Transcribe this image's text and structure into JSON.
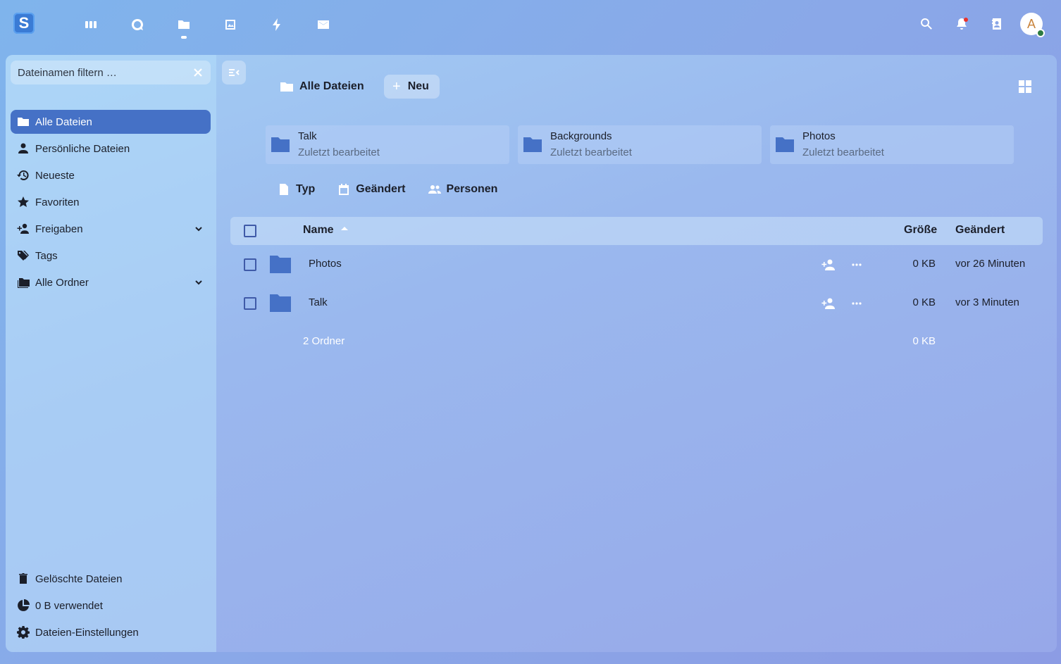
{
  "header": {
    "logo_letter": "S",
    "apps": [
      {
        "name": "dashboard-icon",
        "label": "Dashboard"
      },
      {
        "name": "talk-icon",
        "label": "Talk"
      },
      {
        "name": "files-icon",
        "label": "Files"
      },
      {
        "name": "photos-icon",
        "label": "Photos"
      },
      {
        "name": "activity-icon",
        "label": "Activity"
      },
      {
        "name": "mail-icon",
        "label": "Mail"
      }
    ],
    "active_app": "files",
    "avatar_letter": "A",
    "status_color": "#2d7b41"
  },
  "sidebar": {
    "filter_placeholder": "Dateinamen filtern …",
    "items": [
      {
        "label": "Alle Dateien",
        "icon": "folder-icon",
        "active": true
      },
      {
        "label": "Persönliche Dateien",
        "icon": "person-icon"
      },
      {
        "label": "Neueste",
        "icon": "history-icon"
      },
      {
        "label": "Favoriten",
        "icon": "star-icon"
      },
      {
        "label": "Freigaben",
        "icon": "share-icon",
        "expandable": true
      },
      {
        "label": "Tags",
        "icon": "tags-icon"
      },
      {
        "label": "Alle Ordner",
        "icon": "folders-icon",
        "expandable": true
      }
    ],
    "bottom": {
      "trash": "Gelöschte Dateien",
      "quota": "0 B verwendet",
      "settings": "Dateien-Einstellungen"
    }
  },
  "toolbar": {
    "breadcrumb": "Alle Dateien",
    "new_label": "Neu"
  },
  "recent": [
    {
      "name": "Talk",
      "subtitle": "Zuletzt bearbeitet"
    },
    {
      "name": "Backgrounds",
      "subtitle": "Zuletzt bearbeitet"
    },
    {
      "name": "Photos",
      "subtitle": "Zuletzt bearbeitet"
    }
  ],
  "filters": {
    "type": "Typ",
    "modified": "Geändert",
    "people": "Personen"
  },
  "table": {
    "headers": {
      "name": "Name",
      "size": "Größe",
      "modified": "Geändert"
    },
    "rows": [
      {
        "name": "Photos",
        "size": "0 KB",
        "modified": "vor 26 Minuten"
      },
      {
        "name": "Talk",
        "size": "0 KB",
        "modified": "vor 3 Minuten"
      }
    ],
    "summary": {
      "count": "2 Ordner",
      "size": "0 KB"
    }
  },
  "colors": {
    "accent": "#4571c6",
    "folder": "#4571c6"
  }
}
